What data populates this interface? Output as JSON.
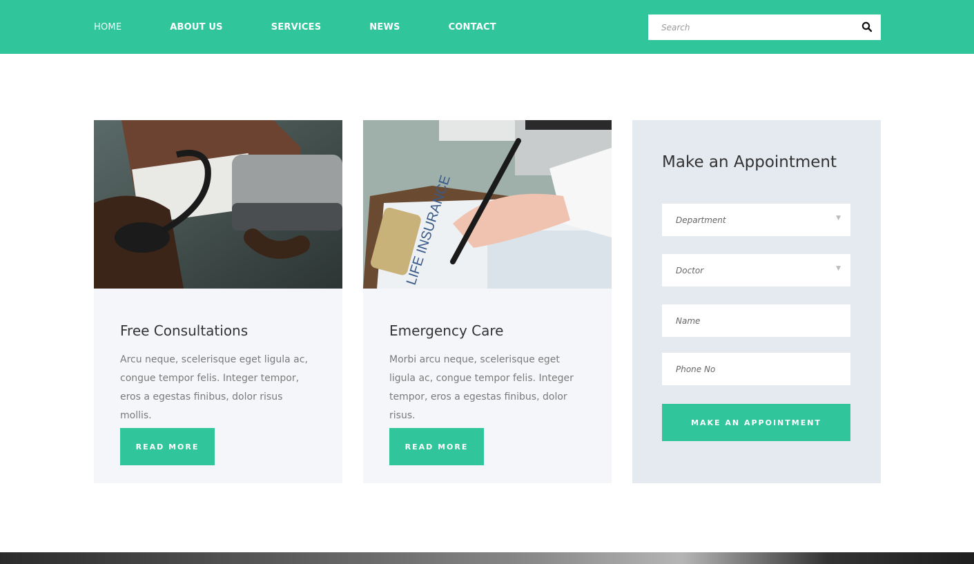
{
  "nav": {
    "items": [
      "HOME",
      "ABOUT US",
      "SERVICES",
      "NEWS",
      "CONTACT"
    ],
    "search_placeholder": "Search",
    "search_icon": "search-icon"
  },
  "cards": [
    {
      "image": "blood-pressure-photo",
      "title": "Free Consultations",
      "text": "Arcu neque, scelerisque eget ligula ac, congue tempor felis. Integer tempor, eros a egestas finibus, dolor risus mollis.",
      "button": "READ MORE"
    },
    {
      "image": "life-insurance-form-photo",
      "title": "Emergency Care",
      "text": "Morbi arcu neque, scelerisque eget ligula ac, congue tempor felis. Integer tempor, eros a egestas finibus, dolor risus.",
      "button": "READ MORE"
    }
  ],
  "appointment": {
    "title": "Make an Appointment",
    "department_placeholder": "Department",
    "doctor_placeholder": "Doctor",
    "name_placeholder": "Name",
    "phone_placeholder": "Phone No",
    "button": "MAKE AN APPOINTMENT"
  },
  "colors": {
    "accent": "#31c59b",
    "card_bg": "#f4f6f9",
    "panel_bg": "#e4eaf0"
  }
}
